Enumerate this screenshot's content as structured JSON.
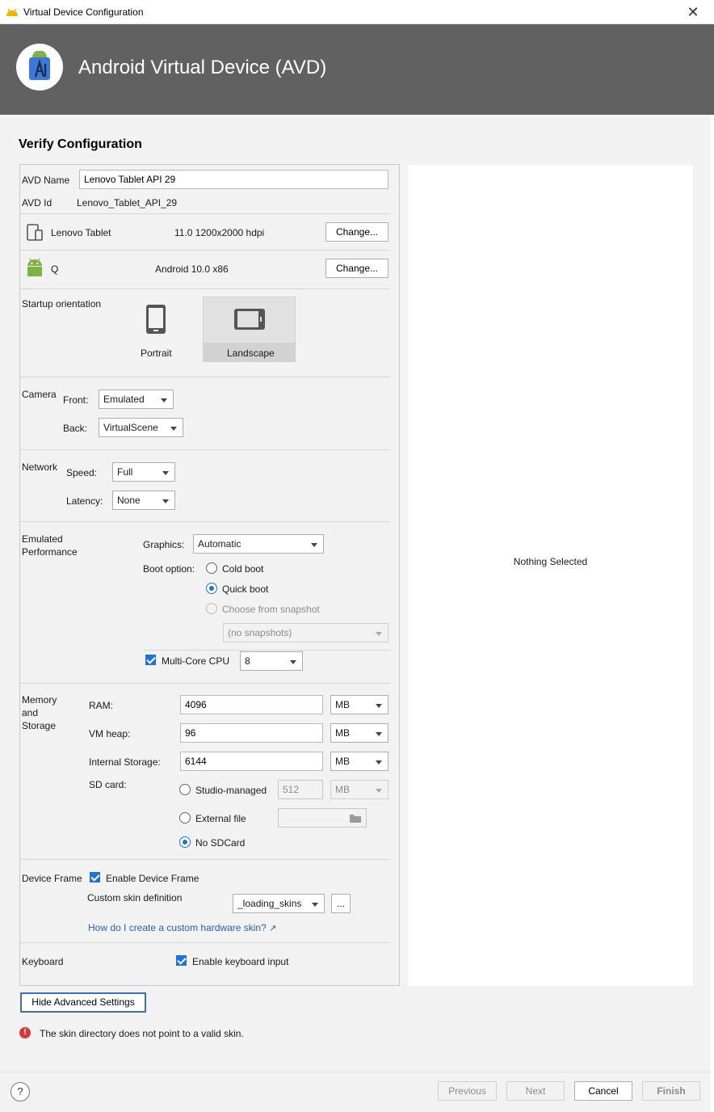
{
  "window": {
    "title": "Virtual Device Configuration",
    "close_glyph": "✕"
  },
  "banner": {
    "title": "Android Virtual Device (AVD)"
  },
  "page": {
    "heading": "Verify Configuration"
  },
  "avd": {
    "name_label": "AVD Name",
    "name_value": "Lenovo Tablet API 29",
    "id_label": "AVD Id",
    "id_value": "Lenovo_Tablet_API_29"
  },
  "device": {
    "name": "Lenovo Tablet",
    "spec": "11.0 1200x2000 hdpi",
    "change_label": "Change..."
  },
  "system_image": {
    "name": "Q",
    "spec": "Android 10.0 x86",
    "change_label": "Change..."
  },
  "orientation": {
    "label": "Startup orientation",
    "portrait": "Portrait",
    "landscape": "Landscape",
    "selected": "Landscape"
  },
  "camera": {
    "label": "Camera",
    "front_label": "Front:",
    "front_value": "Emulated",
    "back_label": "Back:",
    "back_value": "VirtualScene"
  },
  "network": {
    "label": "Network",
    "speed_label": "Speed:",
    "speed_value": "Full",
    "latency_label": "Latency:",
    "latency_value": "None"
  },
  "performance": {
    "label_line1": "Emulated",
    "label_line2": "Performance",
    "graphics_label": "Graphics:",
    "graphics_value": "Automatic",
    "boot_label": "Boot option:",
    "cold_boot": "Cold boot",
    "quick_boot": "Quick boot",
    "snapshot": "Choose from snapshot",
    "snapshot_value": "(no snapshots)",
    "boot_selected": "Quick boot",
    "multicore_label": "Multi-Core CPU",
    "multicore_checked": true,
    "multicore_value": "8"
  },
  "memory": {
    "label_line1": "Memory",
    "label_line2": "and",
    "label_line3": "Storage",
    "ram_label": "RAM:",
    "ram_value": "4096",
    "ram_unit": "MB",
    "vmheap_label": "VM heap:",
    "vmheap_value": "96",
    "vmheap_unit": "MB",
    "internal_label": "Internal Storage:",
    "internal_value": "6144",
    "internal_unit": "MB",
    "sdcard_label": "SD card:",
    "studio_managed": "Studio-managed",
    "studio_value": "512",
    "studio_unit": "MB",
    "external_file": "External file",
    "no_sdcard": "No SDCard",
    "sdcard_selected": "No SDCard"
  },
  "device_frame": {
    "label": "Device Frame",
    "enable_label": "Enable Device Frame",
    "enable_checked": true,
    "skin_label": "Custom skin definition",
    "skin_value": "_loading_skins",
    "browse_label": "...",
    "help_link": "How do I create a custom hardware skin?",
    "link_arrow": "↗"
  },
  "keyboard": {
    "label": "Keyboard",
    "enable_label": "Enable keyboard input",
    "enable_checked": true
  },
  "advanced_button": "Hide Advanced Settings",
  "error": {
    "icon_glyph": "!",
    "message": "The skin directory does not point to a valid skin."
  },
  "preview": {
    "empty_text": "Nothing Selected"
  },
  "footer": {
    "help_glyph": "?",
    "previous": "Previous",
    "next": "Next",
    "cancel": "Cancel",
    "finish": "Finish"
  },
  "colors": {
    "banner_bg": "#616161",
    "accent": "#1e73d8",
    "android_green": "#7cb342",
    "error_red": "#d63b3b",
    "link": "#2a5fb0"
  }
}
